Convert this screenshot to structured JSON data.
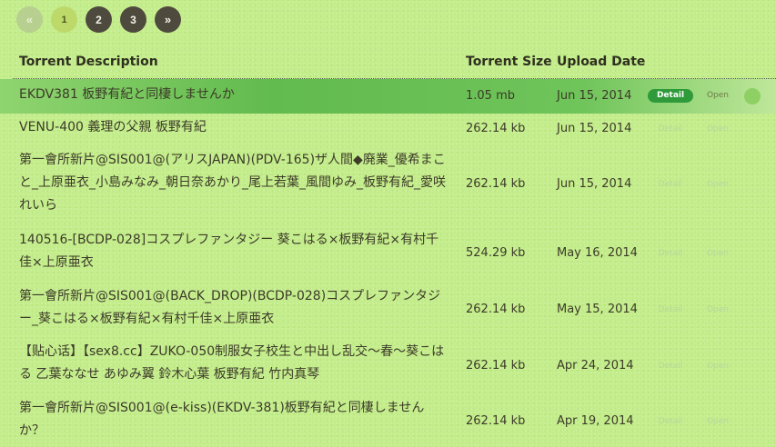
{
  "pagination": {
    "prev": "«",
    "pages": [
      "1",
      "2",
      "3"
    ],
    "next": "»",
    "active": "1"
  },
  "table": {
    "headers": [
      "Torrent Description",
      "Torrent Size",
      "Upload Date"
    ],
    "rows": [
      {
        "desc": "EKDV381 板野有紀と同棲しませんか",
        "size": "1.05 mb",
        "date": "Jun 15, 2014",
        "detail": "Detail",
        "open": "Open"
      },
      {
        "desc": "VENU-400 義理の父親 板野有紀",
        "size": "262.14 kb",
        "date": "Jun 15, 2014",
        "detail": "Detail",
        "open": "Open"
      },
      {
        "desc": "第一會所新片@SIS001@(アリスJAPAN)(PDV-165)ザ人間◆廃業_優希まこと_上原亜衣_小島みなみ_朝日奈あかり_尾上若葉_風間ゆみ_板野有紀_愛咲れいら",
        "size": "262.14 kb",
        "date": "Jun 15, 2014",
        "detail": "Detail",
        "open": "Open"
      },
      {
        "desc": "140516-[BCDP-028]コスプレファンタジー 葵こはる×板野有紀×有村千佳×上原亜衣",
        "size": "524.29 kb",
        "date": "May 16, 2014",
        "detail": "Detail",
        "open": "Open"
      },
      {
        "desc": "第一會所新片@SIS001@(BACK_DROP)(BCDP-028)コスプレファンタジー_葵こはる×板野有紀×有村千佳×上原亜衣",
        "size": "262.14 kb",
        "date": "May 15, 2014",
        "detail": "Detail",
        "open": "Open"
      },
      {
        "desc": "【贴心话】【sex8.cc】ZUKO-050制服女子校生と中出し乱交～春～葵こはる 乙葉ななせ あゆみ翼 鈴木心葉 板野有紀 竹内真琴",
        "size": "262.14 kb",
        "date": "Apr 24, 2014",
        "detail": "Detail",
        "open": "Open"
      },
      {
        "desc": "第一會所新片@SIS001@(e-kiss)(EKDV-381)板野有紀と同棲しませんか？",
        "size": "262.14 kb",
        "date": "Apr 19, 2014",
        "detail": "Detail",
        "open": "Open"
      }
    ]
  },
  "colors": {
    "background": "#c3ed8a",
    "highlight": "#62bb4e",
    "detail_button": "#2e9a3a",
    "page_dark": "#4f4a3e",
    "page_active": "#bdd96a"
  }
}
